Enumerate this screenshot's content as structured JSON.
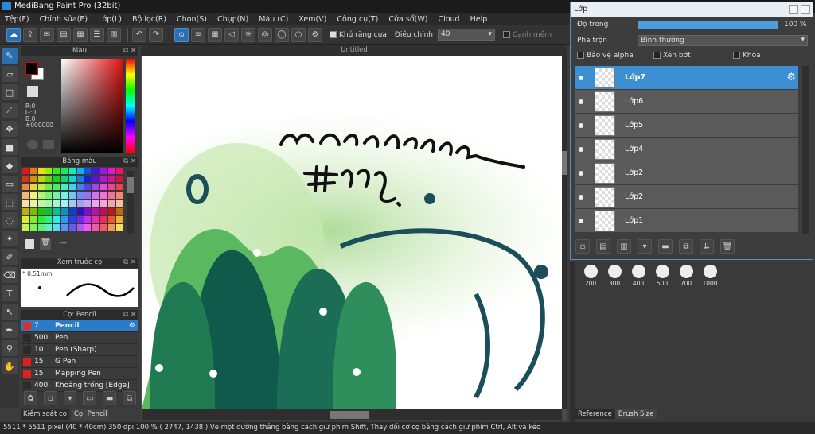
{
  "app": {
    "title": "MediBang Paint Pro (32bit)"
  },
  "menu": [
    "Tệp(F)",
    "Chỉnh sửa(E)",
    "Lớp(L)",
    "Bộ lọc(R)",
    "Chọn(S)",
    "Chụp(N)",
    "Màu (C)",
    "Xem(V)",
    "Công cụ(T)",
    "Cửa sổ(W)",
    "Cloud",
    "Help"
  ],
  "toolbar": {
    "antialias_label": "Khử răng cưa",
    "adjust_label": "Điều chỉnh",
    "adjust_value": "40",
    "sharp_label": "Cạnh mềm"
  },
  "color_panel": {
    "title": "Màu",
    "r": "R:0",
    "g": "G:0",
    "b": "B:0",
    "hex": "#000000",
    "fg": "#000000",
    "bg": "#ffffff"
  },
  "swatch_panel": {
    "title": "Bảng màu",
    "add_label": "---"
  },
  "preview_panel": {
    "title": "Xem trước cọ",
    "size": "0.51mm"
  },
  "brush_panel": {
    "title": "Cọ: Pencil",
    "items": [
      {
        "size": "7",
        "name": "Pencil",
        "color": "#d93030"
      },
      {
        "size": "500",
        "name": "Pen",
        "color": "#2b2b2b"
      },
      {
        "size": "10",
        "name": "Pen (Sharp)",
        "color": "#2b2b2b"
      },
      {
        "size": "15",
        "name": "G Pen",
        "color": "#e02020"
      },
      {
        "size": "15",
        "name": "Mapping Pen",
        "color": "#e02020"
      },
      {
        "size": "400",
        "name": "Khoảng trống [Edge]",
        "color": "#2b2b2b"
      }
    ]
  },
  "bottom_tabs": [
    "Kiểm soát co",
    "Cọ: Pencil"
  ],
  "canvas": {
    "tab": "Untitled"
  },
  "status": {
    "text": "5511 * 5511 pixel   (40 * 40cm)   350 dpi   100 %   ( 2747, 1438 )   Vẽ một đường thẳng bằng cách giữ phím Shift, Thay đổi cỡ cọ bằng cách giữ phím Ctrl, Alt và kéo"
  },
  "layer_panel": {
    "title": "Lớp",
    "opacity_label": "Độ trong",
    "opacity_value": "100 %",
    "blend_label": "Pha trộn",
    "blend_value": "Bình thường",
    "protect_alpha": "Bảo vệ alpha",
    "clipping": "Xén bớt",
    "lock": "Khóa",
    "layers": [
      "Lớp7",
      "Lớp6",
      "Lớp5",
      "Lớp4",
      "Lớp2",
      "Lớp2",
      "Lớp1"
    ]
  },
  "brush_sizes": [
    "200",
    "300",
    "400",
    "500",
    "700",
    "1000"
  ],
  "right_tabs": [
    "Reference",
    "Brush Size"
  ]
}
